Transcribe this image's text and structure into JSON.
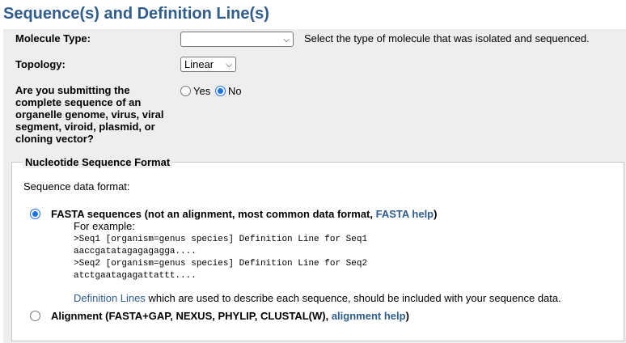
{
  "page": {
    "title": "Sequence(s) and Definition Line(s)"
  },
  "form": {
    "molecule_type": {
      "label": "Molecule Type:",
      "value": "",
      "hint": "Select the type of molecule that was isolated and sequenced."
    },
    "topology": {
      "label": "Topology:",
      "value": "Linear"
    },
    "complete_sequence": {
      "label_lines": [
        "Are you submitting the",
        "complete sequence of an",
        "organelle genome, virus, viral",
        "segment, viroid, plasmid, or",
        "cloning vector?"
      ],
      "yes_label": "Yes",
      "no_label": "No",
      "selected": "No"
    }
  },
  "format": {
    "legend": "Nucleotide Sequence Format",
    "data_format_label": "Sequence data format:",
    "fasta": {
      "label": "FASTA sequences (not an alignment, most common data format,",
      "help_link": "FASTA help",
      "close": ")",
      "example_label": "For example:",
      "example_lines": [
        ">Seq1 [organism=genus species] Definition Line for Seq1",
        "aaccgatatagagagagga....",
        ">Seq2 [organism=genus species] Definition Line for Seq2",
        "atctgaatagagattattt...."
      ],
      "defline_link": "Definition Lines",
      "defline_text": "which are used to describe each sequence, should be included with your sequence data.",
      "selected": true
    },
    "alignment": {
      "label": "Alignment (FASTA+GAP, NEXUS, PHYLIP, CLUSTAL(W),",
      "help_link": "alignment help",
      "close": ")",
      "selected": false
    }
  },
  "colors": {
    "link": "#2f5d8e",
    "panel_bg": "#eeeeee",
    "radio_accent": "#1a73e8"
  },
  "icons": {
    "select_arrow": "chevron-down-icon"
  }
}
